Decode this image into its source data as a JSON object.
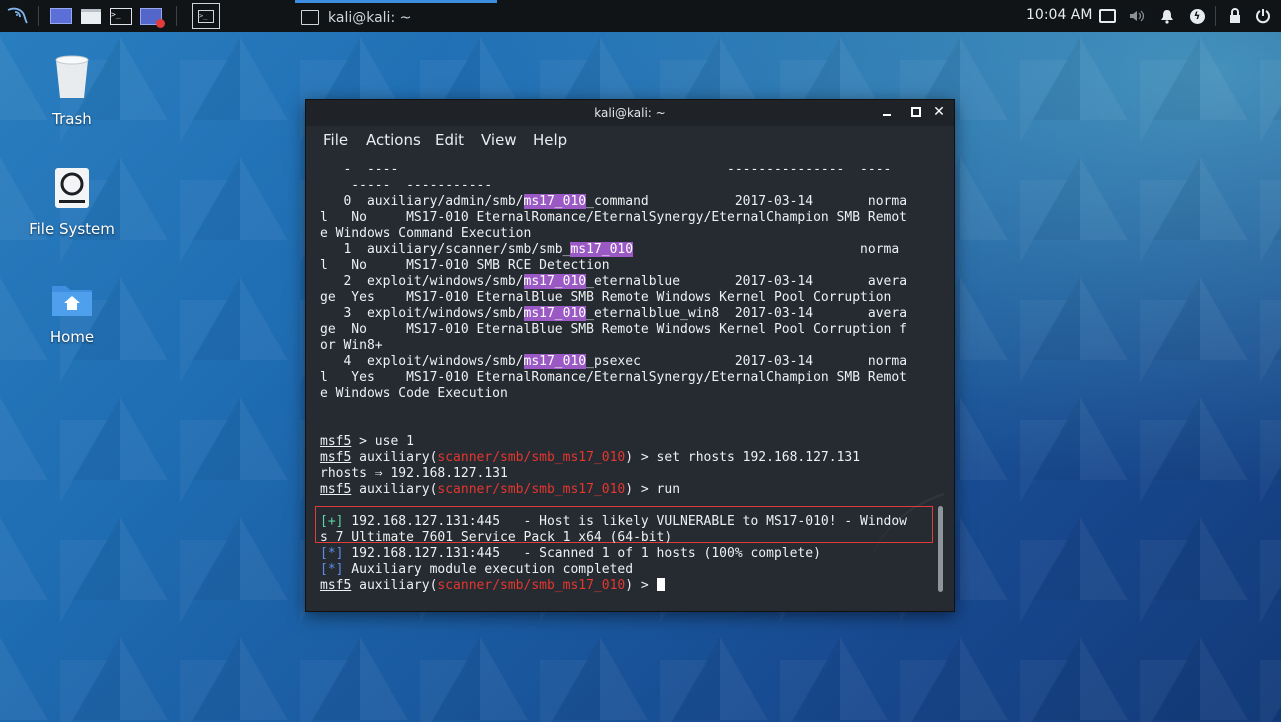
{
  "panel": {
    "launchers": [
      "kali-menu-icon",
      "workspace-icon",
      "file-manager-icon",
      "terminal-icon",
      "screen-recorder-icon",
      "show-desktop-icon"
    ],
    "task_title": "kali@kali: ~",
    "clock": "10:04 AM"
  },
  "desktop": {
    "icons": [
      {
        "label": "Trash"
      },
      {
        "label": "File System"
      },
      {
        "label": "Home"
      }
    ]
  },
  "terminal": {
    "title": "kali@kali: ~",
    "menu": [
      "File",
      "Actions",
      "Edit",
      "View",
      "Help"
    ],
    "lines": {
      "l0": "   -  ----                                          ---------------  ----",
      "l1": "    -----  -----------",
      "m0_pre": "   0  auxiliary/admin/smb/",
      "m0_hl": "ms17_010",
      "m0_post": "_command           2017-03-14       norma",
      "m0_b": "l   No     MS17-010 EternalRomance/EternalSynergy/EternalChampion SMB Remot",
      "m0_c": "e Windows Command Execution",
      "m1_pre": "   1  auxiliary/scanner/smb/smb_",
      "m1_hl": "ms17_010",
      "m1_post": "                             norma",
      "m1_b": "l   No     MS17-010 SMB RCE Detection",
      "m2_pre": "   2  exploit/windows/smb/",
      "m2_hl": "ms17_010",
      "m2_post": "_eternalblue       2017-03-14       avera",
      "m2_b": "ge  Yes    MS17-010 EternalBlue SMB Remote Windows Kernel Pool Corruption",
      "m3_pre": "   3  exploit/windows/smb/",
      "m3_hl": "ms17_010",
      "m3_post": "_eternalblue_win8  2017-03-14       avera",
      "m3_b": "ge  No     MS17-010 EternalBlue SMB Remote Windows Kernel Pool Corruption f",
      "m3_c": "or Win8+",
      "m4_pre": "   4  exploit/windows/smb/",
      "m4_hl": "ms17_010",
      "m4_post": "_psexec            2017-03-14       norma",
      "m4_b": "l   Yes    MS17-010 EternalRomance/EternalSynergy/EternalChampion SMB Remot",
      "m4_c": "e Windows Code Execution",
      "prompt": "msf5",
      "cmd_use": " > use 1",
      "aux_open": " auxiliary(",
      "module": "scanner/smb/smb_ms17_010",
      "cmd_set": ") > set rhosts 192.168.127.131",
      "rhosts_out": "rhosts ⇒ 192.168.127.131",
      "cmd_run": ") > run",
      "plus": "[+]",
      "vuln_a": " 192.168.127.131:445   - Host is likely VULNERABLE to MS17-010! - Window",
      "vuln_b": "s 7 Ultimate 7601 Service Pack 1 x64 (64-bit)",
      "star": "[*]",
      "scanned": " 192.168.127.131:445   - Scanned 1 of 1 hosts (100% complete)",
      "done": " Auxiliary module execution completed",
      "cmd_final": ") > "
    }
  }
}
